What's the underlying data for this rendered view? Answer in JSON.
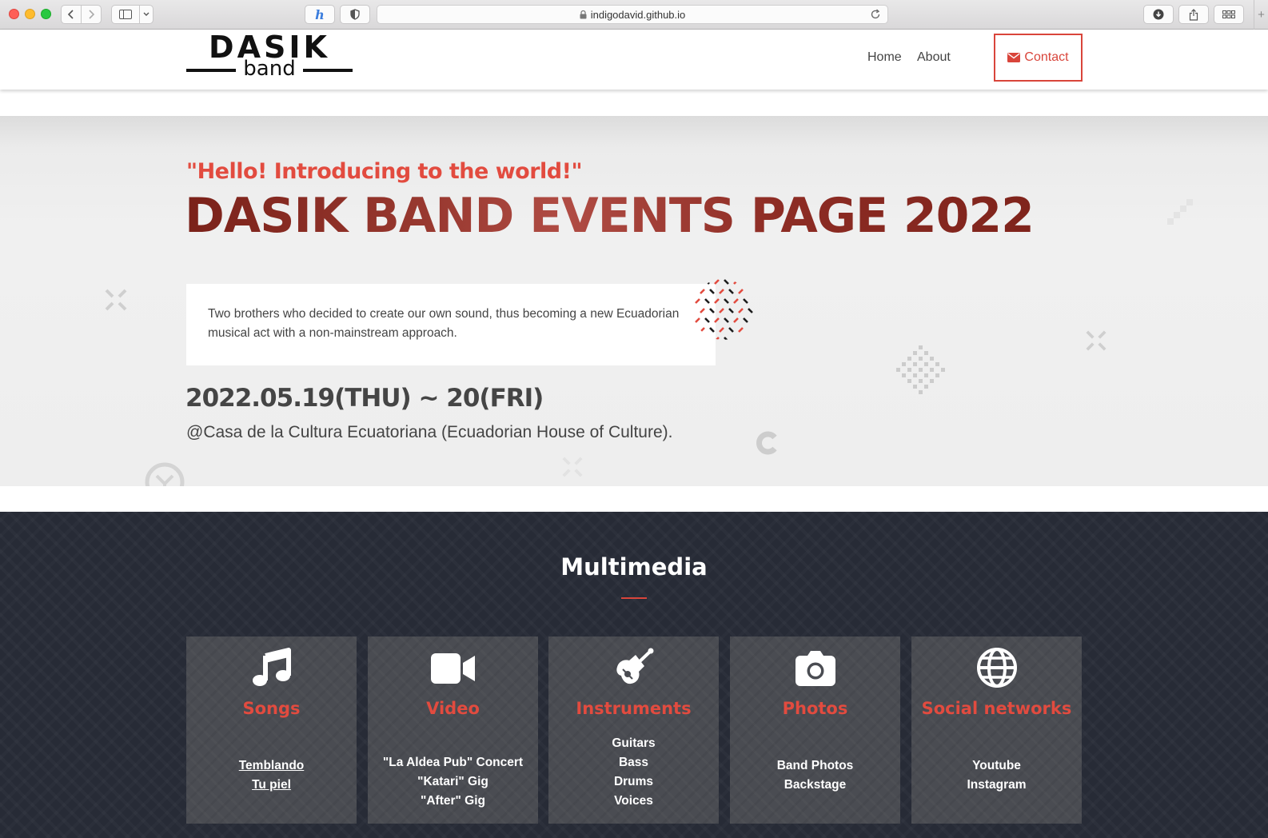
{
  "browser": {
    "url": "indigodavid.github.io"
  },
  "header": {
    "logo_main": "DASIK",
    "logo_sub": "band",
    "nav": {
      "home": "Home",
      "about": "About",
      "contact": "Contact"
    }
  },
  "hero": {
    "tagline": "\"Hello! Introducing to the world!\"",
    "title": "DASIK BAND EVENTS PAGE 2022",
    "description": "Two brothers who decided to create our own sound, thus becoming a new Ecuadorian musical act with a non-mainstream approach.",
    "date": "2022.05.19(THU) ~ 20(FRI)",
    "venue": "@Casa de la Cultura Ecuatoriana (Ecuadorian House of Culture)."
  },
  "multimedia": {
    "title": "Multimedia",
    "cards": [
      {
        "title": "Songs",
        "items": [
          "Temblando",
          "Tu piel"
        ],
        "icon": "music-icon"
      },
      {
        "title": "Video",
        "items": [
          "\"La Aldea Pub\" Concert",
          "\"Katari\" Gig",
          "\"After\" Gig"
        ],
        "icon": "video-icon"
      },
      {
        "title": "Instruments",
        "items": [
          "Guitars",
          "Bass",
          "Drums",
          "Voices"
        ],
        "icon": "guitar-icon"
      },
      {
        "title": "Photos",
        "items": [
          "Band Photos",
          "Backstage"
        ],
        "icon": "camera-icon"
      },
      {
        "title": "Social networks",
        "items": [
          "Youtube",
          "Instagram"
        ],
        "icon": "globe-icon"
      }
    ]
  },
  "colors": {
    "accent": "#d9453b",
    "title_dark_red": "#8b2a22",
    "multimedia_bg": "#272b36",
    "card_bg": "#4a4c52"
  }
}
